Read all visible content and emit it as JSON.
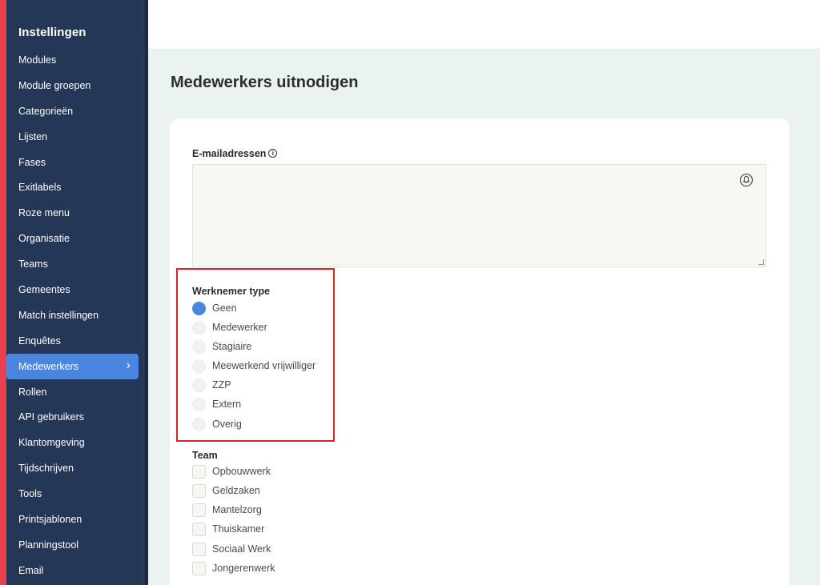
{
  "sidebar": {
    "title": "Instellingen",
    "items": [
      {
        "label": "Modules"
      },
      {
        "label": "Module groepen"
      },
      {
        "label": "Categorieën"
      },
      {
        "label": "Lijsten"
      },
      {
        "label": "Fases"
      },
      {
        "label": "Exitlabels"
      },
      {
        "label": "Roze menu"
      },
      {
        "label": "Organisatie"
      },
      {
        "label": "Teams"
      },
      {
        "label": "Gemeentes"
      },
      {
        "label": "Match instellingen"
      },
      {
        "label": "Enquêtes"
      },
      {
        "label": "Medewerkers",
        "active": true
      },
      {
        "label": "Rollen"
      },
      {
        "label": "API gebruikers"
      },
      {
        "label": "Klantomgeving"
      },
      {
        "label": "Tijdschrijven"
      },
      {
        "label": "Tools"
      },
      {
        "label": "Printsjablonen"
      },
      {
        "label": "Planningstool"
      },
      {
        "label": "Email"
      }
    ],
    "active_chevron": "›"
  },
  "page": {
    "title": "Medewerkers uitnodigen"
  },
  "form": {
    "email_label": "E-mailadressen",
    "email_value": "",
    "info_icon": "ⓘ",
    "employee_type": {
      "label": "Werknemer type",
      "options": [
        "Geen",
        "Medewerker",
        "Stagiaire",
        "Meewerkend vrijwilliger",
        "ZZP",
        "Extern",
        "Overig"
      ],
      "selected": "Geen"
    },
    "team": {
      "label": "Team",
      "options": [
        "Opbouwwerk",
        "Geldzaken",
        "Mantelzorg",
        "Thuiskamer",
        "Sociaal Werk",
        "Jongerenwerk"
      ]
    }
  },
  "colors": {
    "accent": "#e8404f",
    "sidebar_bg": "#253757",
    "active_item": "#4a86e0",
    "highlight": "#e0202a"
  }
}
